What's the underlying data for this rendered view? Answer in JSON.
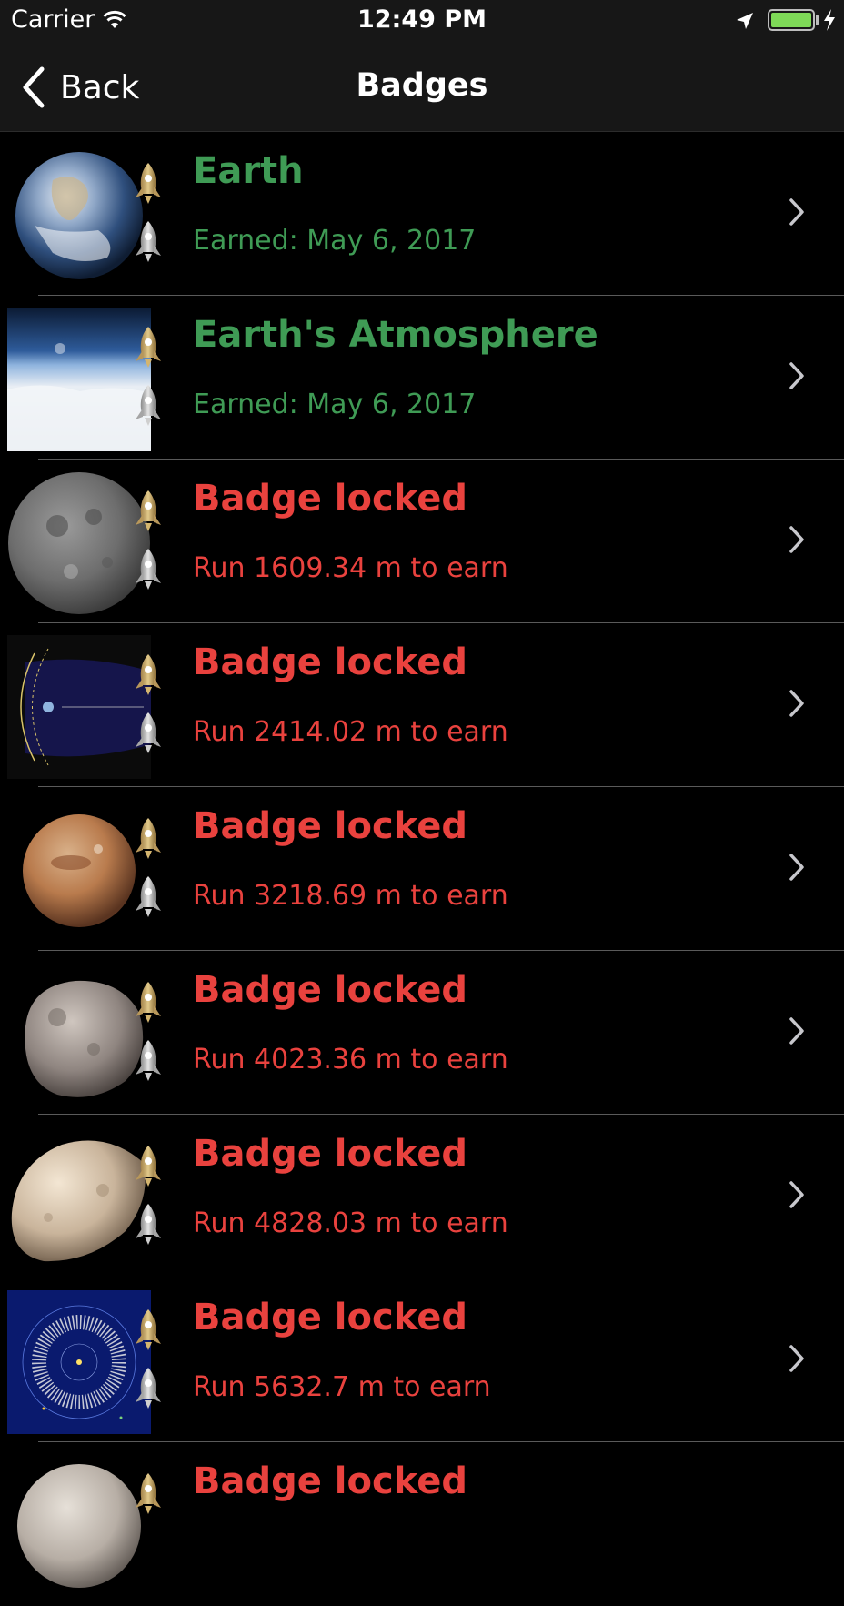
{
  "status_bar": {
    "carrier": "Carrier",
    "time": "12:49 PM",
    "battery_level": 1.0,
    "icons": [
      "wifi-icon",
      "location-arrow-icon",
      "battery-icon",
      "charging-bolt-icon"
    ]
  },
  "nav": {
    "back_label": "Back",
    "title": "Badges"
  },
  "colors": {
    "earned": "#3f9b55",
    "locked": "#e9423e",
    "background": "#000000",
    "bar": "#171717"
  },
  "badges": [
    {
      "title": "Earth",
      "subtitle": "Earned: May 6, 2017",
      "state": "earned",
      "image": "earth"
    },
    {
      "title": "Earth's Atmosphere",
      "subtitle": "Earned: May 6, 2017",
      "state": "earned",
      "image": "atmosphere"
    },
    {
      "title": "Badge locked",
      "subtitle": "Run 1609.34 m to earn",
      "state": "locked",
      "image": "moon"
    },
    {
      "title": "Badge locked",
      "subtitle": "Run 2414.02 m to earn",
      "state": "locked",
      "image": "magnetosphere"
    },
    {
      "title": "Badge locked",
      "subtitle": "Run 3218.69 m to earn",
      "state": "locked",
      "image": "mars"
    },
    {
      "title": "Badge locked",
      "subtitle": "Run 4023.36 m to earn",
      "state": "locked",
      "image": "phobos"
    },
    {
      "title": "Badge locked",
      "subtitle": "Run 4828.03 m to earn",
      "state": "locked",
      "image": "deimos"
    },
    {
      "title": "Badge locked",
      "subtitle": "Run 5632.7 m to earn",
      "state": "locked",
      "image": "asteroid-belt"
    },
    {
      "title": "Badge locked",
      "subtitle": "",
      "state": "locked",
      "image": "ceres"
    }
  ]
}
